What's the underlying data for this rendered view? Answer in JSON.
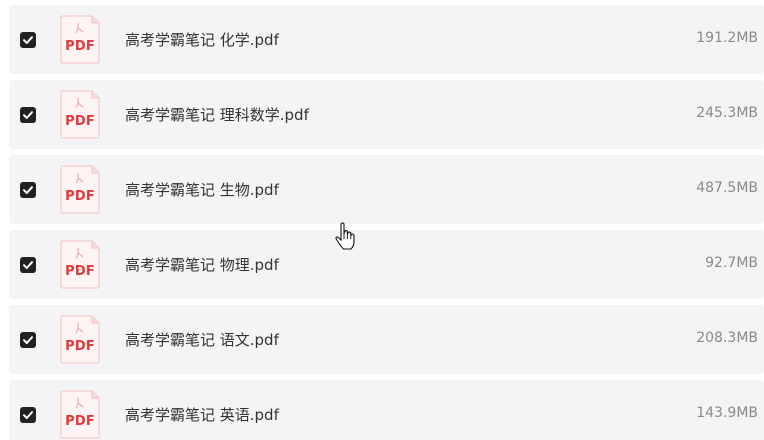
{
  "file_list": {
    "items": [
      {
        "name": "高考学霸笔记 化学.pdf",
        "size": "191.2MB",
        "checked": true,
        "icon": "pdf-icon",
        "icon_text": "PDF"
      },
      {
        "name": "高考学霸笔记 理科数学.pdf",
        "size": "245.3MB",
        "checked": true,
        "icon": "pdf-icon",
        "icon_text": "PDF"
      },
      {
        "name": "高考学霸笔记 生物.pdf",
        "size": "487.5MB",
        "checked": true,
        "icon": "pdf-icon",
        "icon_text": "PDF"
      },
      {
        "name": "高考学霸笔记 物理.pdf",
        "size": "92.7MB",
        "checked": true,
        "icon": "pdf-icon",
        "icon_text": "PDF"
      },
      {
        "name": "高考学霸笔记 语文.pdf",
        "size": "208.3MB",
        "checked": true,
        "icon": "pdf-icon",
        "icon_text": "PDF"
      },
      {
        "name": "高考学霸笔记 英语.pdf",
        "size": "143.9MB",
        "checked": true,
        "icon": "pdf-icon",
        "icon_text": "PDF"
      }
    ]
  },
  "colors": {
    "row_background": "#f4f4f6",
    "checkbox_fill": "#222222",
    "pdf_accent": "#e03a3a",
    "name_text": "#333333",
    "size_text": "#8a8a8a"
  },
  "cursor": {
    "icon": "hand-pointer-cursor"
  }
}
